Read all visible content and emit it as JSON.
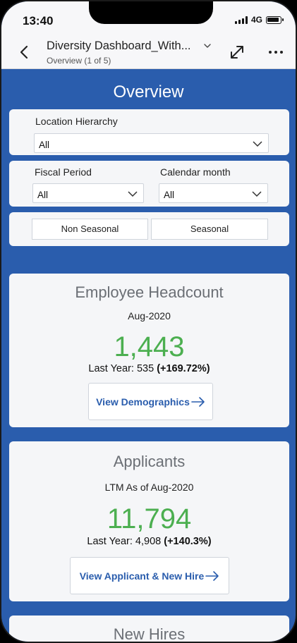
{
  "status": {
    "time": "13:40",
    "network": "4G"
  },
  "header": {
    "title": "Diversity Dashboard_With...",
    "subtitle": "Overview (1 of 5)"
  },
  "icons": [
    "back-arrow-icon",
    "chevron-down-icon",
    "expand-icon",
    "more-icon",
    "signal-icon",
    "battery-icon",
    "arrow-right-icon"
  ],
  "page_title": "Overview",
  "filters": {
    "location": {
      "label": "Location Hierarchy",
      "value": "All"
    },
    "fiscal": {
      "label": "Fiscal Period",
      "value": "All"
    },
    "calendar": {
      "label": "Calendar month",
      "value": "All"
    },
    "seasonal_options": [
      "Non Seasonal",
      "Seasonal"
    ]
  },
  "cards": {
    "headcount": {
      "title": "Employee Headcount",
      "period": "Aug-2020",
      "value": "1,443",
      "last_year_text": "Last Year: 535",
      "change": "(+169.72%)",
      "button": "View Demographics"
    },
    "applicants": {
      "title": "Applicants",
      "period": "LTM As of Aug-2020",
      "value": "11,794",
      "last_year_text": "Last Year: 4,908",
      "change": "(+140.3%)",
      "button": "View Applicant & New Hire"
    },
    "new_hires": {
      "title": "New Hires"
    }
  },
  "colors": {
    "background": "#2a5dad",
    "accent_green": "#4caf50",
    "link_blue": "#2a5dad"
  }
}
